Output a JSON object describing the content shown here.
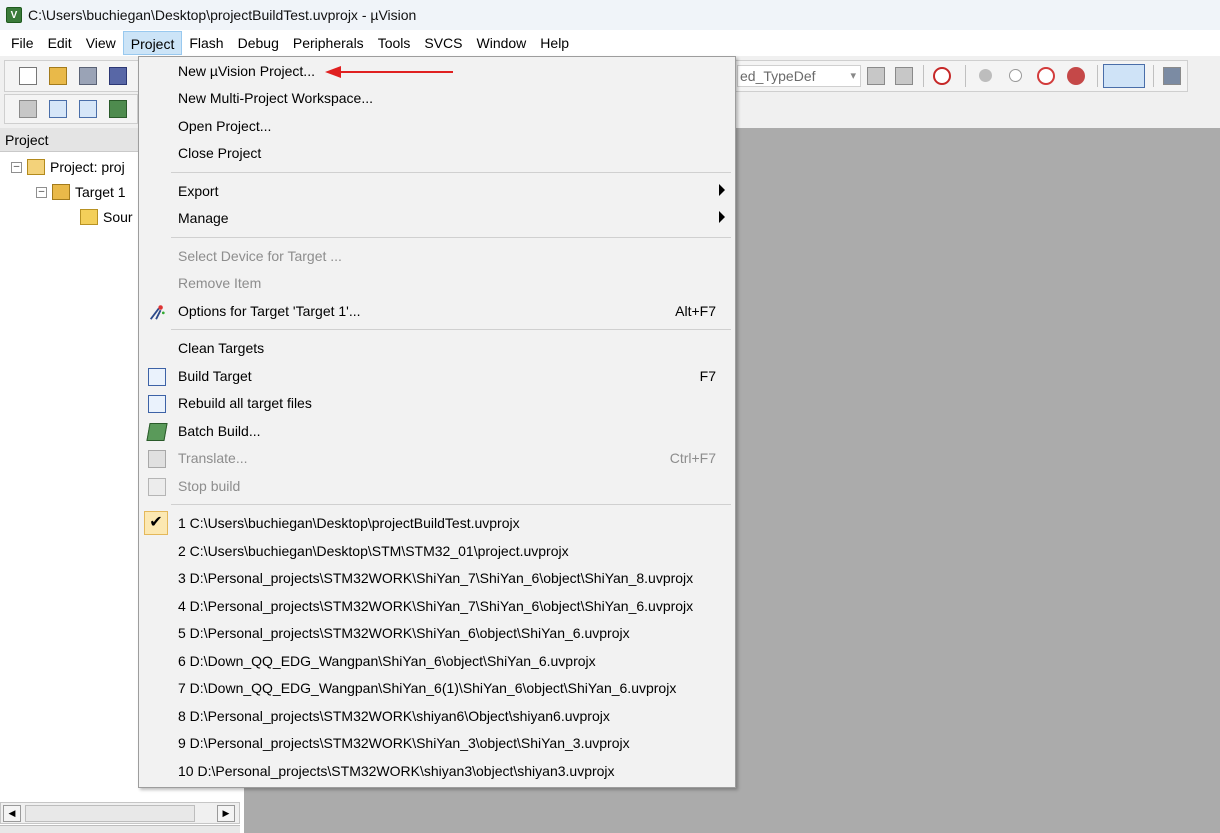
{
  "window": {
    "title": "C:\\Users\\buchiegan\\Desktop\\projectBuildTest.uvprojx - µVision",
    "icon": "uvision-app-icon"
  },
  "menubar": {
    "items": [
      {
        "label": "File"
      },
      {
        "label": "Edit"
      },
      {
        "label": "View"
      },
      {
        "label": "Project",
        "active": true
      },
      {
        "label": "Flash"
      },
      {
        "label": "Debug"
      },
      {
        "label": "Peripherals"
      },
      {
        "label": "Tools"
      },
      {
        "label": "SVCS"
      },
      {
        "label": "Window"
      },
      {
        "label": "Help"
      }
    ]
  },
  "toolbar": {
    "target_combo_value": "ed_TypeDef"
  },
  "project_panel": {
    "header": "Project",
    "tree": {
      "root_label": "Project: proj",
      "target_label": "Target 1",
      "group_label": "Sour"
    }
  },
  "project_menu": {
    "items": {
      "new_project": {
        "label": "New µVision Project..."
      },
      "new_workspace": {
        "label": "New Multi-Project Workspace..."
      },
      "open_project": {
        "label": "Open Project..."
      },
      "close_project": {
        "label": "Close Project"
      },
      "export": {
        "label": "Export"
      },
      "manage": {
        "label": "Manage"
      },
      "select_device": {
        "label": "Select Device for Target ...",
        "disabled": true
      },
      "remove_item": {
        "label": "Remove Item",
        "disabled": true
      },
      "options_target": {
        "label": "Options for Target 'Target 1'...",
        "shortcut": "Alt+F7"
      },
      "clean_targets": {
        "label": "Clean Targets"
      },
      "build_target": {
        "label": "Build Target",
        "shortcut": "F7"
      },
      "rebuild_all": {
        "label": "Rebuild all target files"
      },
      "batch_build": {
        "label": "Batch Build..."
      },
      "translate": {
        "label": "Translate...",
        "shortcut": "Ctrl+F7",
        "disabled": true
      },
      "stop_build": {
        "label": "Stop build",
        "disabled": true
      }
    },
    "recent_projects": [
      "1 C:\\Users\\buchiegan\\Desktop\\projectBuildTest.uvprojx",
      "2 C:\\Users\\buchiegan\\Desktop\\STM\\STM32_01\\project.uvprojx",
      "3 D:\\Personal_projects\\STM32WORK\\ShiYan_7\\ShiYan_6\\object\\ShiYan_8.uvprojx",
      "4 D:\\Personal_projects\\STM32WORK\\ShiYan_7\\ShiYan_6\\object\\ShiYan_6.uvprojx",
      "5 D:\\Personal_projects\\STM32WORK\\ShiYan_6\\object\\ShiYan_6.uvprojx",
      "6 D:\\Down_QQ_EDG_Wangpan\\ShiYan_6\\object\\ShiYan_6.uvprojx",
      "7 D:\\Down_QQ_EDG_Wangpan\\ShiYan_6(1)\\ShiYan_6\\object\\ShiYan_6.uvprojx",
      "8 D:\\Personal_projects\\STM32WORK\\shiyan6\\Object\\shiyan6.uvprojx",
      "9 D:\\Personal_projects\\STM32WORK\\ShiYan_3\\object\\ShiYan_3.uvprojx",
      "10 D:\\Personal_projects\\STM32WORK\\shiyan3\\object\\shiyan3.uvprojx"
    ],
    "checked_recent_index": 0
  },
  "colors": {
    "annotation_arrow": "#e02020",
    "menu_active_bg": "#cce4f7",
    "disabled_text": "#8d8d8d",
    "workspace_bg": "#ababab"
  }
}
